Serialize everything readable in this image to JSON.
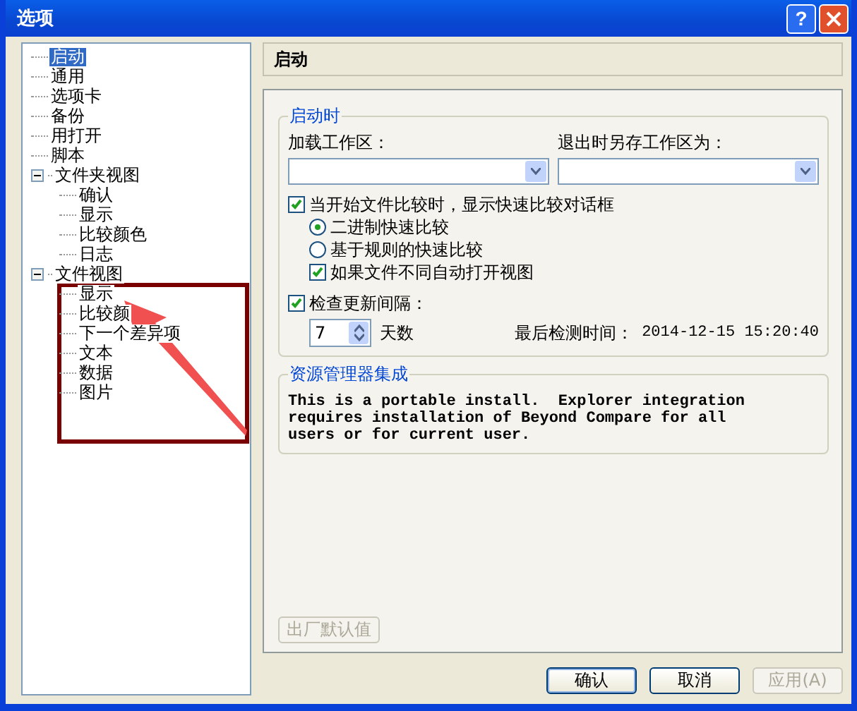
{
  "window": {
    "title": "选项",
    "help_button": "?"
  },
  "tree": [
    {
      "label": "启动",
      "selected": true
    },
    {
      "label": "通用",
      "selected": false
    },
    {
      "label": "选项卡",
      "selected": false
    },
    {
      "label": "备份",
      "selected": false
    },
    {
      "label": "用打开",
      "selected": false
    },
    {
      "label": "脚本",
      "selected": false
    },
    {
      "label": "文件夹视图",
      "selected": false,
      "expanded": true,
      "children": [
        {
          "label": "确认",
          "selected": false
        },
        {
          "label": "显示",
          "selected": false
        },
        {
          "label": "比较颜色",
          "selected": false
        },
        {
          "label": "日志",
          "selected": false
        }
      ]
    },
    {
      "label": "文件视图",
      "selected": false,
      "expanded": true,
      "children": [
        {
          "label": "显示",
          "selected": false
        },
        {
          "label": "比较颜",
          "selected": false
        },
        {
          "label": "下一个差异项",
          "selected": false
        },
        {
          "label": "文本",
          "selected": false
        },
        {
          "label": "数据",
          "selected": false
        },
        {
          "label": "图片",
          "selected": false
        }
      ]
    }
  ],
  "page_header": "启动",
  "startup_group": {
    "title": "启动时",
    "load_workspace": {
      "label": "加载工作区："
    },
    "save_workspace": {
      "label": "退出时另存工作区为："
    },
    "options": [
      {
        "kind": "checkbox",
        "label": "当开始文件比较时，显示快速比较对话框",
        "checked": true,
        "children": [
          {
            "kind": "radio",
            "label": "二进制快速比较",
            "selected": true
          },
          {
            "kind": "radio",
            "label": "基于规则的快速比较",
            "selected": false
          },
          {
            "kind": "checkbox",
            "label": "如果文件不同自动打开视图",
            "checked": true
          }
        ]
      },
      {
        "kind": "checkbox",
        "label": "检查更新间隔：",
        "checked": true
      }
    ],
    "interval": {
      "value": "7",
      "unit": "天数"
    },
    "last_check": {
      "label": "最后检测时间：",
      "value": "2014-12-15 15:20:40"
    }
  },
  "explorer_group": {
    "title": "资源管理器集成",
    "message": "This is a portable install.  Explorer integration requires installation of Beyond Compare for all users or for current user."
  },
  "defaults_button": {
    "label": "出厂默认值",
    "disabled": true
  },
  "footer_buttons": [
    {
      "label": "确认",
      "disabled": false,
      "default": true
    },
    {
      "label": "取消",
      "disabled": false,
      "default": false
    },
    {
      "label": "应用(A)",
      "disabled": true,
      "default": false
    }
  ]
}
